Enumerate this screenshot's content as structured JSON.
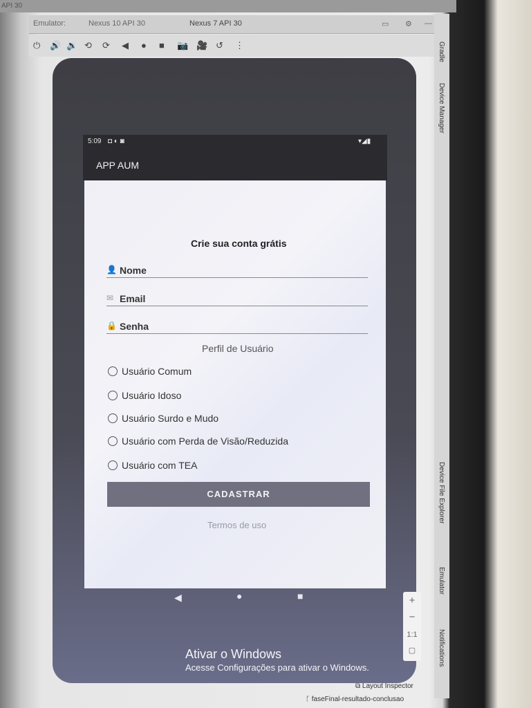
{
  "ide": {
    "top_label": "API 30",
    "tabs": [
      "Emulator:",
      "Nexus 10 API 30",
      "Nexus 7 API 30"
    ],
    "right_panels": [
      "Gradle",
      "Device Manager",
      "Device File Explorer",
      "Emulator",
      "Notifications"
    ],
    "layout_inspector": "Layout Inspector",
    "branch": "faseFinal-resultado-conclusao",
    "zoom_plus": "+",
    "zoom_minus": "−",
    "zoom_ratio": "1:1"
  },
  "toolbar_icons": [
    "power-icon",
    "volume-up-icon",
    "volume-down-icon",
    "rotate-left-icon",
    "rotate-right-icon",
    "back-icon",
    "home-icon",
    "overview-icon",
    "camera-icon",
    "video-icon",
    "undo-icon",
    "more-icon"
  ],
  "device": {
    "status_time": "5:09",
    "app_title": "APP AUM",
    "form": {
      "heading": "Crie sua conta grátis",
      "fields": [
        {
          "label": "Nome",
          "icon": "person-icon"
        },
        {
          "label": "Email",
          "icon": "mail-icon"
        },
        {
          "label": "Senha",
          "icon": "lock-icon"
        }
      ],
      "profile_label": "Perfil de Usuário",
      "options": [
        "Usuário Comum",
        "Usuário Idoso",
        "Usuário Surdo e Mudo",
        "Usuário com Perda de Visão/Reduzida",
        "Usuário com TEA"
      ],
      "submit_label": "CADASTRAR",
      "terms_label": "Termos de uso"
    }
  },
  "windows_watermark": {
    "title": "Ativar o Windows",
    "subtitle": "Acesse Configurações para ativar o Windows."
  }
}
